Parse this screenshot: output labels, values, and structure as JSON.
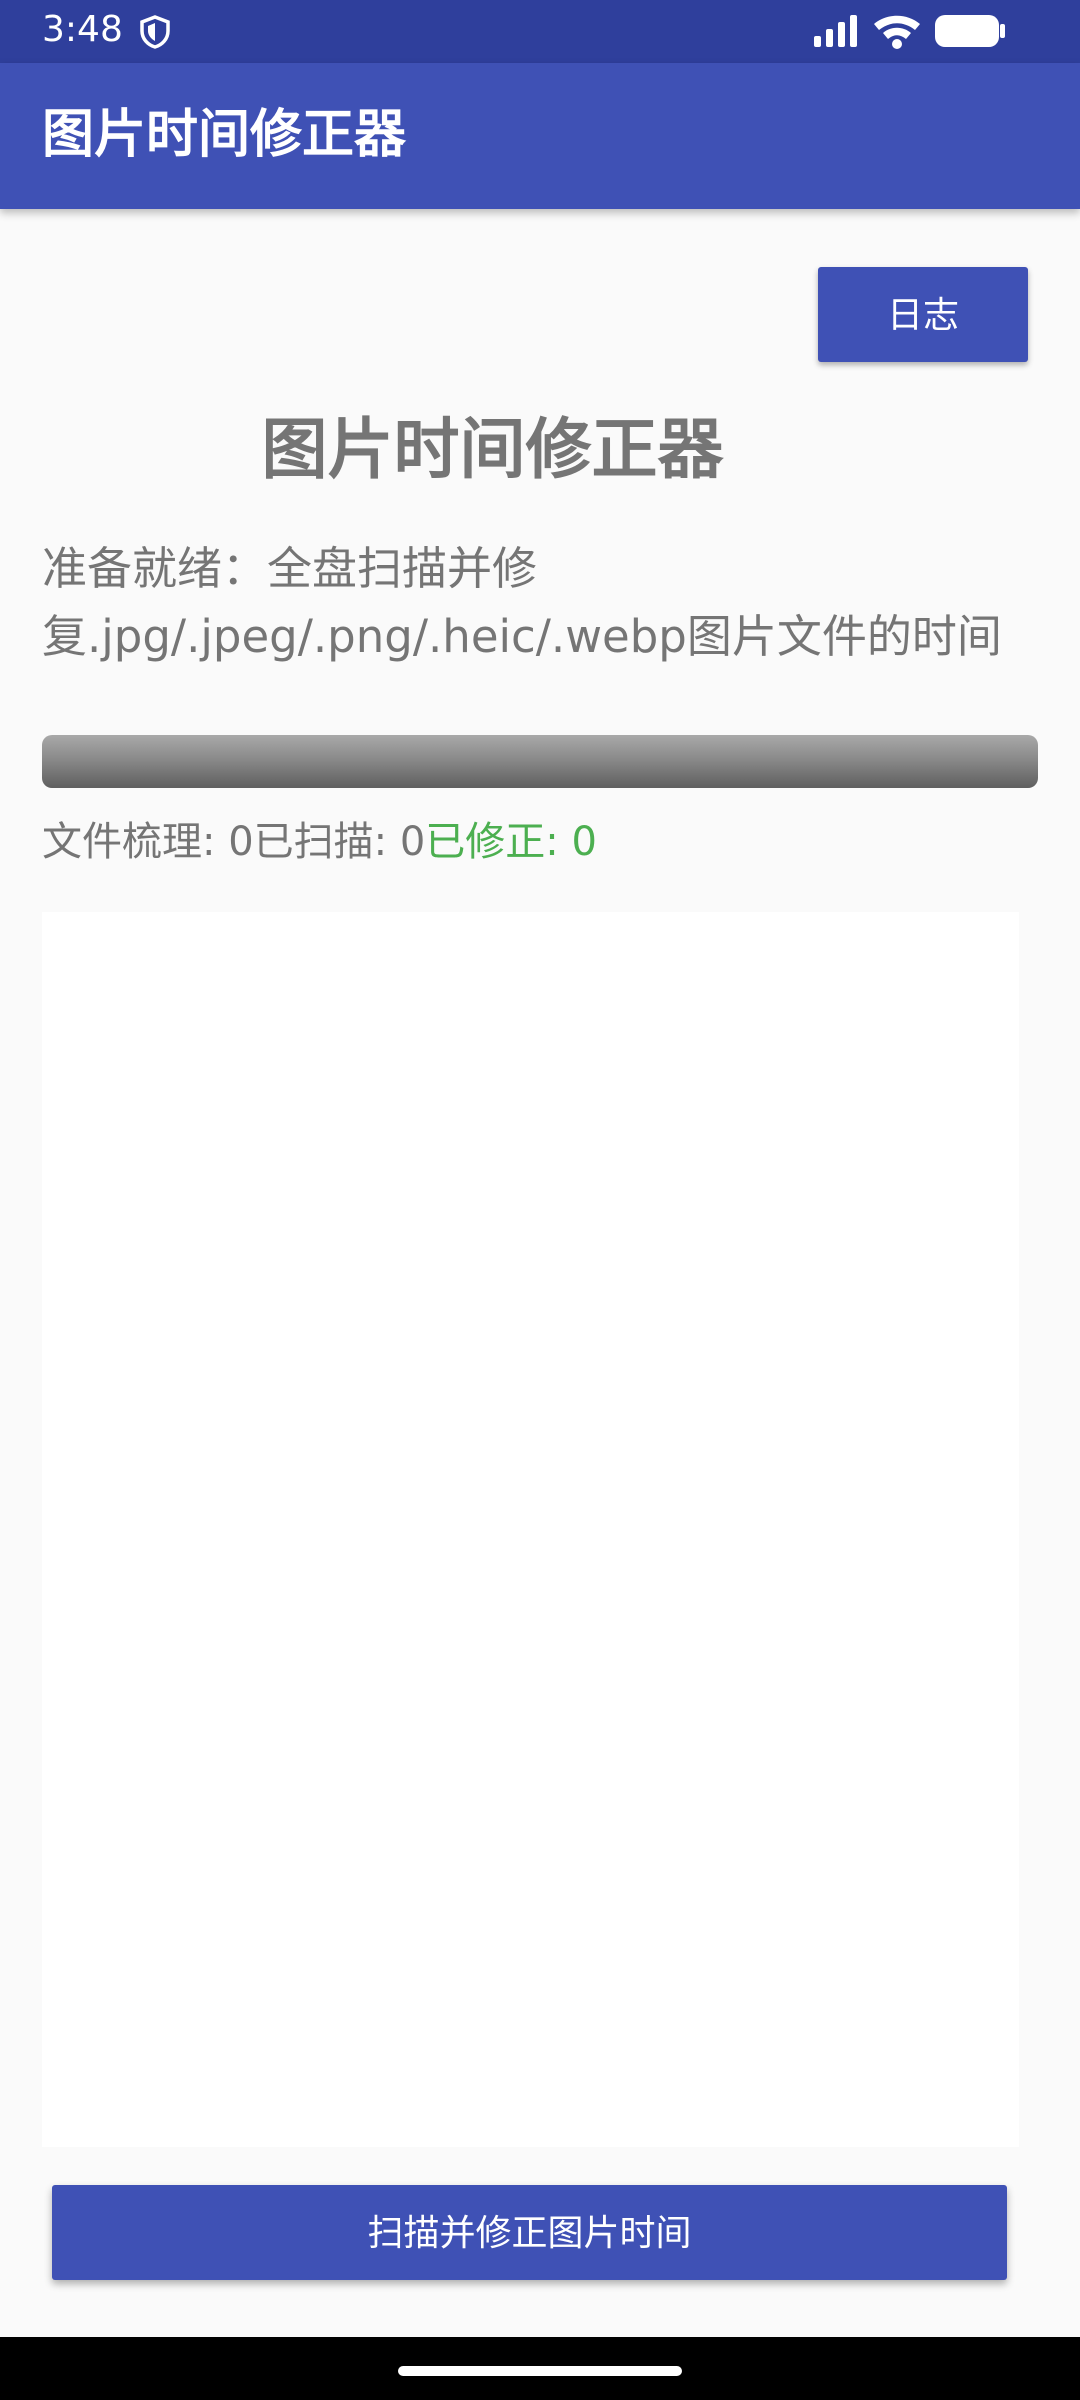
{
  "status_bar": {
    "time": "3:48",
    "icons": [
      "shield-icon",
      "signal-icon",
      "wifi-icon",
      "battery-icon"
    ]
  },
  "app_bar": {
    "title": "图片时间修正器"
  },
  "actions": {
    "log_label": "日志",
    "scan_label": "扫描并修正图片时间"
  },
  "main": {
    "heading": "图片时间修正器",
    "status_message": "准备就绪：全盘扫描并修复.jpg/.jpeg/.png/.heic/.webp图片文件的时间",
    "progress": 0,
    "counts": {
      "sorted_text": "文件梳理: 0",
      "scanned_text": "已扫描: 0",
      "fixed_text": "已修正: 0"
    }
  },
  "colors": {
    "status_bar": "#2f3f9c",
    "primary": "#3f51b5",
    "success": "#4caf50",
    "text_gray": "#757575"
  }
}
